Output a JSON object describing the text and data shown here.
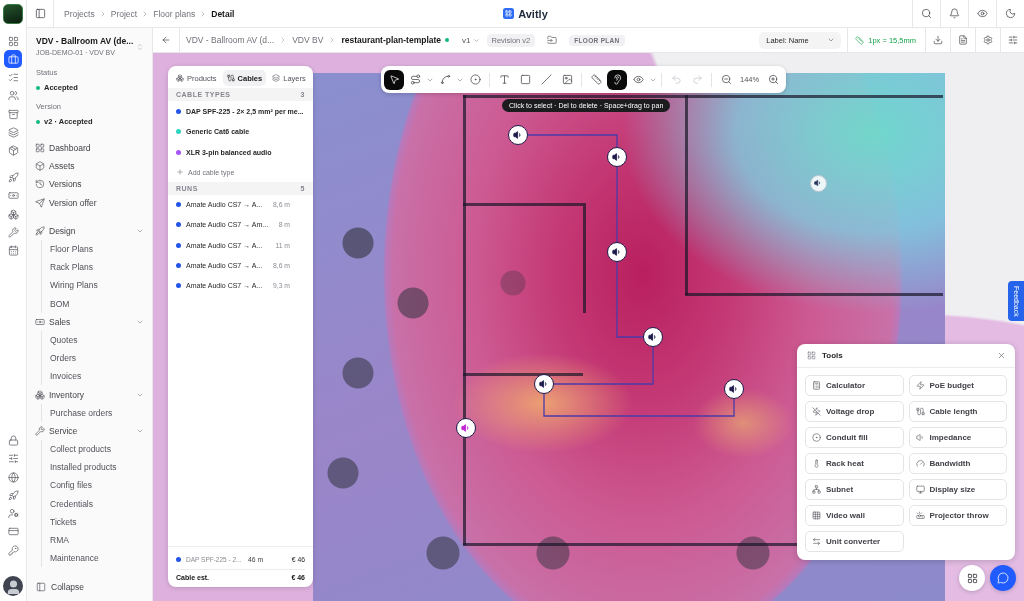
{
  "rail": {
    "groups": [
      [
        {
          "selected": false
        },
        {
          "selected": true
        },
        {
          "selected": false
        },
        {
          "selected": false
        },
        {
          "selected": false
        },
        {
          "selected": false
        },
        {
          "selected": false
        }
      ],
      [
        {
          "selected": false
        },
        {
          "selected": false
        },
        {
          "selected": false
        },
        {
          "selected": false
        },
        {
          "selected": false
        }
      ],
      [
        {
          "selected": false
        },
        {
          "selected": false
        },
        {
          "selected": false
        },
        {
          "selected": false
        },
        {
          "selected": false
        },
        {
          "selected": false
        },
        {
          "selected": false
        }
      ]
    ]
  },
  "breadcrumbs": [
    "Projects",
    "Project",
    "Floor plans",
    "Detail"
  ],
  "app_name": "Avitly",
  "project": {
    "title": "VDV - Ballroom AV (de...",
    "subtitle": "JOB-DEMO-01 · VDV BV",
    "status_label": "Status",
    "status": "Accepted",
    "version_label": "Version",
    "version": "v2 · Accepted"
  },
  "nav": [
    {
      "label": "Dashboard",
      "selected": false
    },
    {
      "label": "Assets",
      "selected": false
    },
    {
      "label": "Versions",
      "selected": false
    },
    {
      "label": "Version offer",
      "selected": false
    },
    {
      "label": "Design",
      "selected": false,
      "expanded": true,
      "children": [
        {
          "label": "Floor Plans",
          "selected": false
        },
        {
          "label": "Rack Plans",
          "selected": false
        },
        {
          "label": "Wiring Plans",
          "selected": false
        },
        {
          "label": "BOM",
          "selected": false
        }
      ]
    },
    {
      "label": "Sales",
      "selected": false,
      "expanded": true,
      "children": [
        {
          "label": "Quotes",
          "selected": false
        },
        {
          "label": "Orders",
          "selected": false
        },
        {
          "label": "Invoices",
          "selected": false
        }
      ]
    },
    {
      "label": "Inventory",
      "selected": false,
      "expanded": true,
      "children": [
        {
          "label": "Purchase orders",
          "selected": false
        }
      ]
    },
    {
      "label": "Service",
      "selected": false,
      "expanded": true,
      "children": [
        {
          "label": "Collect products",
          "selected": false
        },
        {
          "label": "Installed products",
          "selected": false
        },
        {
          "label": "Config files",
          "selected": false
        },
        {
          "label": "Credentials",
          "selected": false
        },
        {
          "label": "Tickets",
          "selected": false
        },
        {
          "label": "RMA",
          "selected": false
        },
        {
          "label": "Maintenance",
          "selected": false
        }
      ]
    }
  ],
  "collapse_label": "Collapse",
  "plan_header": {
    "breadcrumbs": [
      "VDV - Ballroom AV (d...",
      "VDV BV",
      "restaurant-plan-template"
    ],
    "saved": true,
    "version": "v1",
    "revision": "Revision v2",
    "type": "FLOOR PLAN",
    "label_select": "Label: Name",
    "scale": "1px = 15,5mm"
  },
  "toolbar": {
    "groups": [
      [
        {
          "selected": true,
          "disabled": false,
          "menu": false
        },
        {
          "selected": false,
          "disabled": false,
          "menu": true
        },
        {
          "selected": false,
          "disabled": false,
          "menu": true
        },
        {
          "selected": false,
          "disabled": false,
          "menu": false
        }
      ],
      [
        {
          "selected": false,
          "disabled": false,
          "menu": false
        },
        {
          "selected": false,
          "disabled": false,
          "menu": false
        },
        {
          "selected": false,
          "disabled": false,
          "menu": false
        },
        {
          "selected": false,
          "disabled": false,
          "menu": false
        }
      ],
      [
        {
          "selected": false,
          "disabled": false,
          "menu": false
        },
        {
          "selected": true,
          "disabled": false,
          "menu": false
        },
        {
          "selected": false,
          "disabled": false,
          "menu": true
        }
      ],
      [
        {
          "selected": false,
          "disabled": true,
          "menu": false
        },
        {
          "selected": false,
          "disabled": true,
          "menu": false
        }
      ]
    ],
    "zoom": "144%"
  },
  "hint": "Click to select · Del to delete · Space+drag to pan",
  "cables_panel": {
    "tabs": [
      {
        "label": "Products",
        "selected": false
      },
      {
        "label": "Cables",
        "selected": true
      },
      {
        "label": "Layers",
        "selected": false
      }
    ],
    "cable_types": {
      "title": "CABLE TYPES",
      "count": "3",
      "items": [
        {
          "name": "DAP SPF-225 - 2× 2,5 mm² per me...",
          "color": "#2454e6"
        },
        {
          "name": "Generic Cat6 cable",
          "color": "#2dd4bf"
        },
        {
          "name": "XLR 3-pin balanced audio",
          "color": "#a855f7"
        }
      ],
      "add_label": "Add cable type"
    },
    "runs": {
      "title": "RUNS",
      "count": "5",
      "items": [
        {
          "name": "Amate Audio CS7 → A...",
          "length": "8,6 m",
          "color": "#2454e6"
        },
        {
          "name": "Amate Audio CS7 → Am...",
          "length": "8 m",
          "color": "#2454e6"
        },
        {
          "name": "Amate Audio CS7 → A...",
          "length": "11 m",
          "color": "#2454e6"
        },
        {
          "name": "Amate Audio CS7 → A...",
          "length": "8,6 m",
          "color": "#2454e6"
        },
        {
          "name": "Amate Audio CS7 → A...",
          "length": "9,3 m",
          "color": "#2454e6"
        }
      ]
    },
    "summary": {
      "items": [
        {
          "name": "DAP SPF-225 - 2...",
          "length": "46 m",
          "cost": "€ 46",
          "color": "#2454e6"
        }
      ],
      "total_label": "Cable est.",
      "total": "€ 46"
    }
  },
  "tools_panel": {
    "title": "Tools",
    "tools": [
      {
        "label": "Calculator"
      },
      {
        "label": "PoE budget"
      },
      {
        "label": "Voltage drop"
      },
      {
        "label": "Cable length"
      },
      {
        "label": "Conduit fill"
      },
      {
        "label": "Impedance"
      },
      {
        "label": "Rack heat"
      },
      {
        "label": "Bandwidth"
      },
      {
        "label": "Subnet"
      },
      {
        "label": "Display size"
      },
      {
        "label": "Video wall"
      },
      {
        "label": "Projector throw"
      },
      {
        "label": "Unit converter"
      }
    ]
  },
  "feedback": "Feedback"
}
